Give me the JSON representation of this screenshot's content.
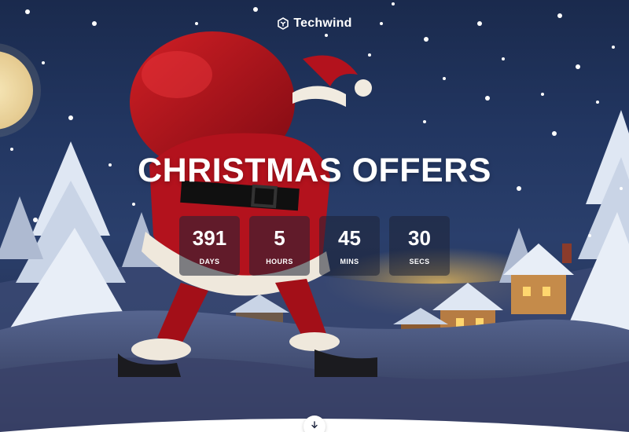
{
  "brand": {
    "name": "Techwind",
    "icon": "logo-icon"
  },
  "headline": "CHRISTMAS OFFERS",
  "countdown": [
    {
      "value": "391",
      "label": "DAYS"
    },
    {
      "value": "5",
      "label": "HOURS"
    },
    {
      "value": "45",
      "label": "MINS"
    },
    {
      "value": "30",
      "label": "SECS"
    }
  ],
  "scroll_button": {
    "icon": "arrow-down-icon"
  },
  "colors": {
    "sky_top": "#1a2a4d",
    "sky_bottom": "#1d2440",
    "santa_red": "#b3121d",
    "countdown_box": "#1e2234",
    "text": "#ffffff"
  }
}
